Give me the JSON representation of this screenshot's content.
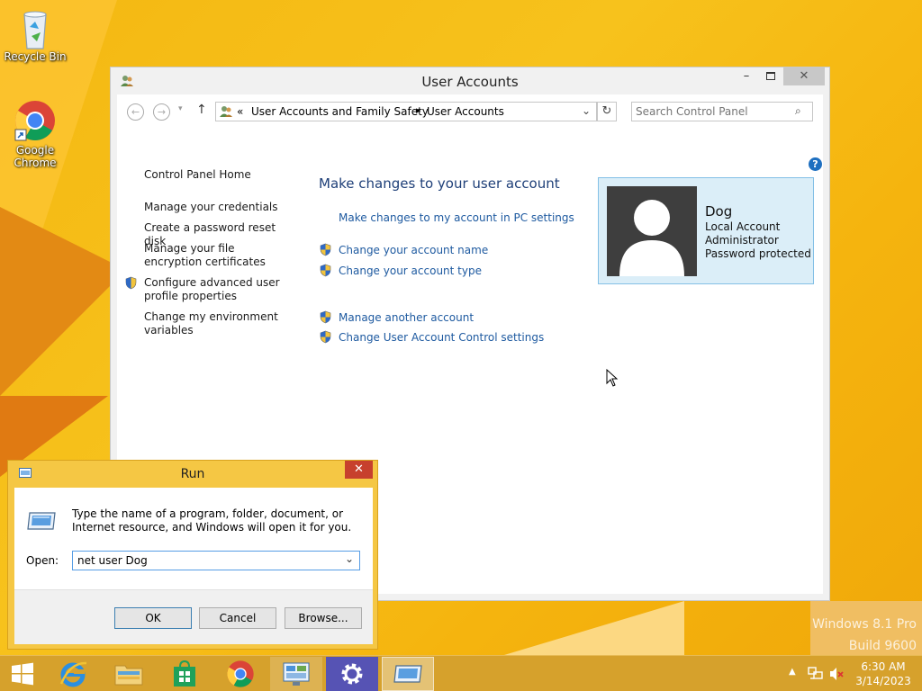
{
  "desktop": {
    "icons": [
      {
        "label": "Recycle Bin"
      },
      {
        "label": "Google Chrome"
      }
    ],
    "watermark": {
      "line1": "Windows 8.1 Pro",
      "line2": "Build 9600"
    }
  },
  "user_accounts": {
    "title": "User Accounts",
    "breadcrumb": {
      "prefix": "«",
      "items": [
        "User Accounts and Family Safety",
        "User Accounts"
      ]
    },
    "search": {
      "placeholder": "Search Control Panel"
    },
    "left_nav": [
      "Control Panel Home",
      "Manage your credentials",
      "Create a password reset disk",
      "Manage your file encryption certificates",
      "Configure advanced user profile properties",
      "Change my environment variables"
    ],
    "heading": "Make changes to your user account",
    "links": {
      "pc_settings": "Make changes to my account in PC settings",
      "change_name": "Change your account name",
      "change_type": "Change your account type",
      "manage_another": "Manage another account",
      "uac": "Change User Account Control settings"
    },
    "account": {
      "name": "Dog",
      "type": "Local Account",
      "role": "Administrator",
      "status": "Password protected"
    }
  },
  "run_dialog": {
    "title": "Run",
    "description": "Type the name of a program, folder, document, or Internet resource, and Windows will open it for you.",
    "open_label": "Open:",
    "open_value": "net user Dog",
    "ok": "OK",
    "cancel": "Cancel",
    "browse": "Browse..."
  },
  "taskbar": {
    "time": "6:30 AM",
    "date": "3/14/2023"
  },
  "colors": {
    "link": "#1e5aa0",
    "account_panel": "#dbeef8",
    "taskbar": "#d6a12c",
    "close_red": "#c7402d"
  }
}
